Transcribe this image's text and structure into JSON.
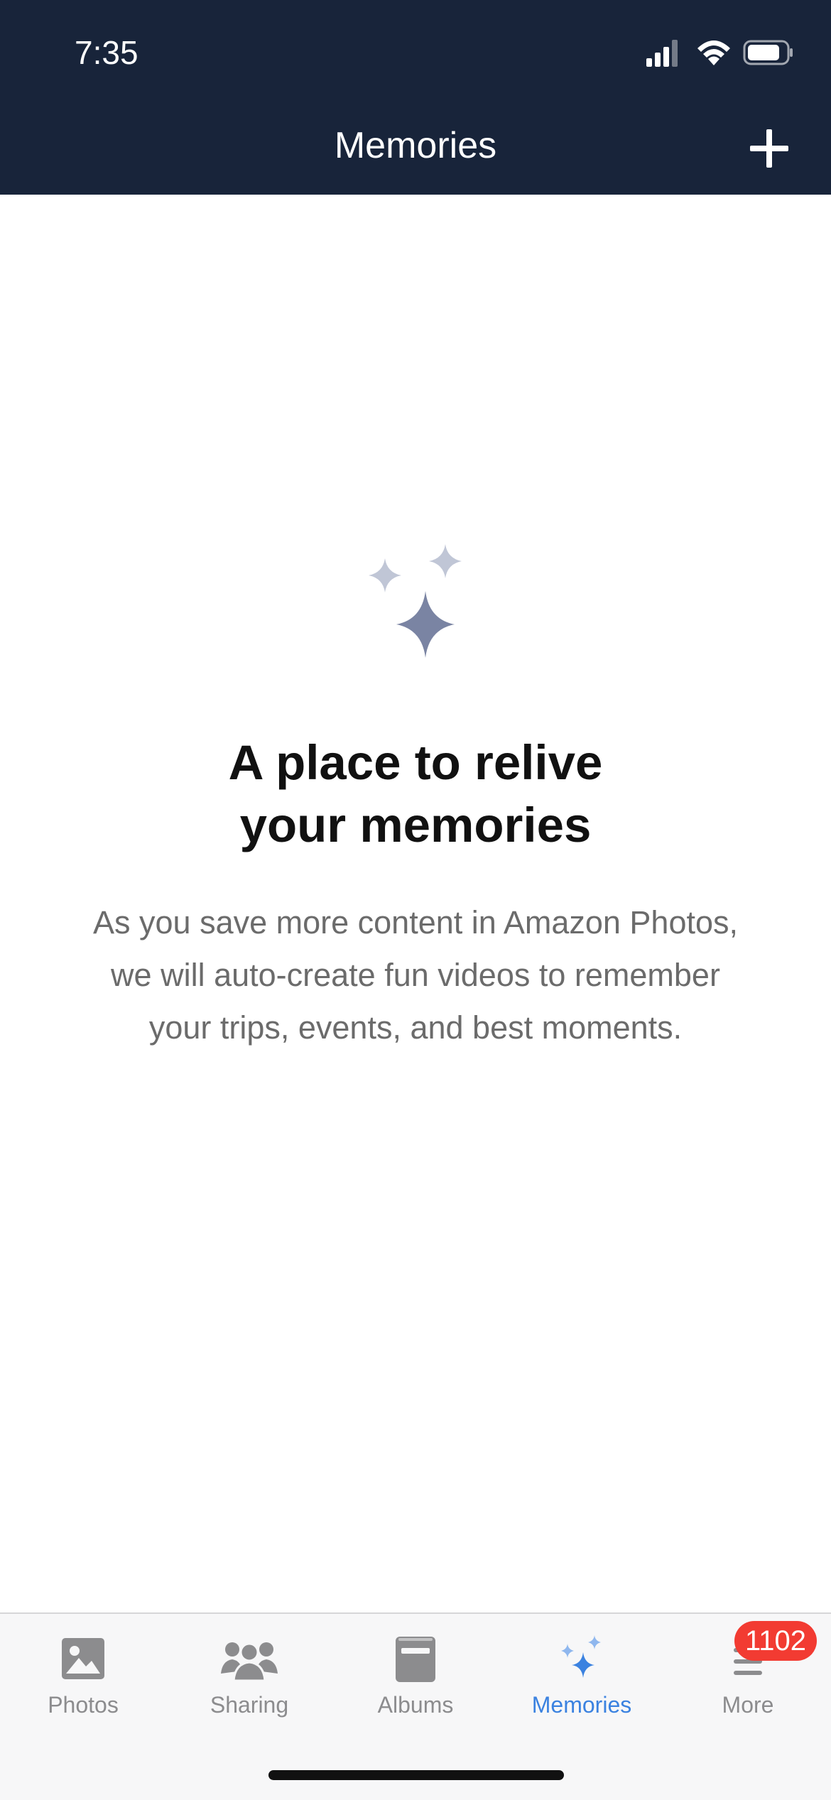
{
  "status_bar": {
    "time": "7:35"
  },
  "header": {
    "title": "Memories",
    "add_icon": "plus-icon"
  },
  "empty_state": {
    "icon": "sparkles-icon",
    "headline_line1": "A place to relive",
    "headline_line2": "your memories",
    "body_line1": "As you save more content in Amazon Photos,",
    "body_line2": "we will auto-create fun videos to remember",
    "body_line3": "your trips, events, and best moments."
  },
  "tabs": [
    {
      "label": "Photos",
      "icon": "photo-icon",
      "active": false
    },
    {
      "label": "Sharing",
      "icon": "people-icon",
      "active": false
    },
    {
      "label": "Albums",
      "icon": "album-icon",
      "active": false
    },
    {
      "label": "Memories",
      "icon": "sparkles-icon",
      "active": true
    },
    {
      "label": "More",
      "icon": "menu-icon",
      "active": false,
      "badge": "1102"
    }
  ],
  "colors": {
    "header_bg": "#18243a",
    "accent": "#3b82e0",
    "badge": "#f23b32"
  }
}
